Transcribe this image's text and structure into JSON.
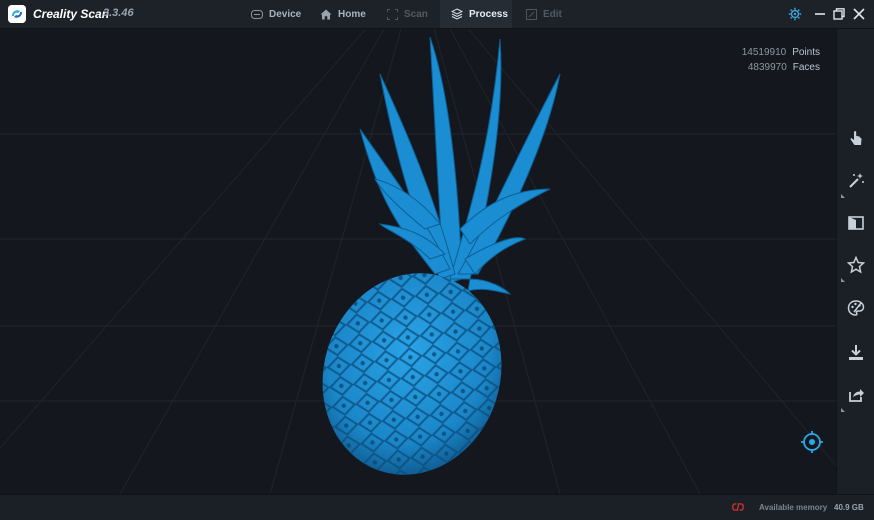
{
  "app": {
    "name": "Creality Scan",
    "version": "3.3.46"
  },
  "tabs": [
    {
      "label": "Device",
      "icon": "device-icon",
      "state": "normal"
    },
    {
      "label": "Home",
      "icon": "home-icon",
      "state": "normal"
    },
    {
      "label": "Scan",
      "icon": "scan-icon",
      "state": "disabled"
    },
    {
      "label": "Process",
      "icon": "layers-icon",
      "state": "active"
    },
    {
      "label": "Edit",
      "icon": "edit-icon",
      "state": "disabled"
    }
  ],
  "window_controls": [
    "settings-icon",
    "minimize-icon",
    "restore-icon",
    "close-icon"
  ],
  "model": {
    "points_value": "14519910",
    "points_label": "Points",
    "faces_value": "4839970",
    "faces_label": "Faces",
    "color": "#1a93d6"
  },
  "tools": [
    "hand-pointer-icon",
    "magic-wand-icon",
    "split-mesh-icon",
    "star-icon",
    "palette-icon",
    "download-icon",
    "share-icon"
  ],
  "status": {
    "memory_label": "Available memory",
    "memory_value": "40.9 GB"
  },
  "colors": {
    "accent": "#2aa7e8",
    "background": "#15191f",
    "warning": "#d8322b"
  }
}
